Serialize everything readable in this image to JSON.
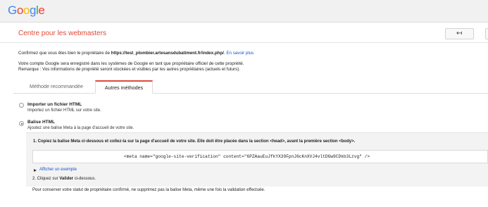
{
  "logo": {
    "letters": [
      "G",
      "o",
      "o",
      "g",
      "l",
      "e"
    ],
    "colors": [
      "#4285f4",
      "#ea4335",
      "#fbbc05",
      "#4285f4",
      "#34a853",
      "#ea4335"
    ]
  },
  "header": {
    "title": "Centre pour les webmasters",
    "back_icon": "arrow-left-icon",
    "back_glyph": "↤"
  },
  "confirm": {
    "prefix": "Confirmez que vous êtes bien le propriétaire de ",
    "url": "https://test_plombier.artesansdubatiment.fr/index.php/",
    "suffix": ". ",
    "link": "En savoir plus"
  },
  "info": {
    "line1": "Votre compte Google sera enregistré dans les systèmes de Google en tant que propriétaire officiel de cette propriété.",
    "line2": "Remarque : Vos informations de propriété seront stockées et visibles par les autres propriétaires (actuels et futurs)."
  },
  "tabs": [
    {
      "label": "Méthode recommandée",
      "active": false
    },
    {
      "label": "Autres méthodes",
      "active": true
    }
  ],
  "options": [
    {
      "title": "Importer un fichier HTML",
      "desc": "Importez un fichier HTML sur votre site.",
      "checked": false
    },
    {
      "title": "Balise HTML",
      "desc": "Ajoutez une balise Meta à la page d'accueil de votre site.",
      "checked": true
    }
  ],
  "instructions": {
    "step1_prefix": "1. Copiez la balise Meta ci-dessous et collez-la sur la page d'accueil de votre site. Elle doit être placée dans la section <head>, avant la première section <body>.",
    "meta_tag": "<meta name=\"google-site-verification\" content=\"6PZAauEuJfkYX39FpnJ6cKnXVJ4vltDGw9CDkb3Lzvg\" />",
    "example_link": "Afficher un exemple",
    "step2_prefix": "2. Cliquez sur ",
    "step2_bold": "Valider",
    "step2_suffix": " ci-dessous.",
    "note": "Pour conserver votre statut de propriétaire confirmé, ne supprimez pas la balise Meta, même une fois la validation effectuée."
  }
}
